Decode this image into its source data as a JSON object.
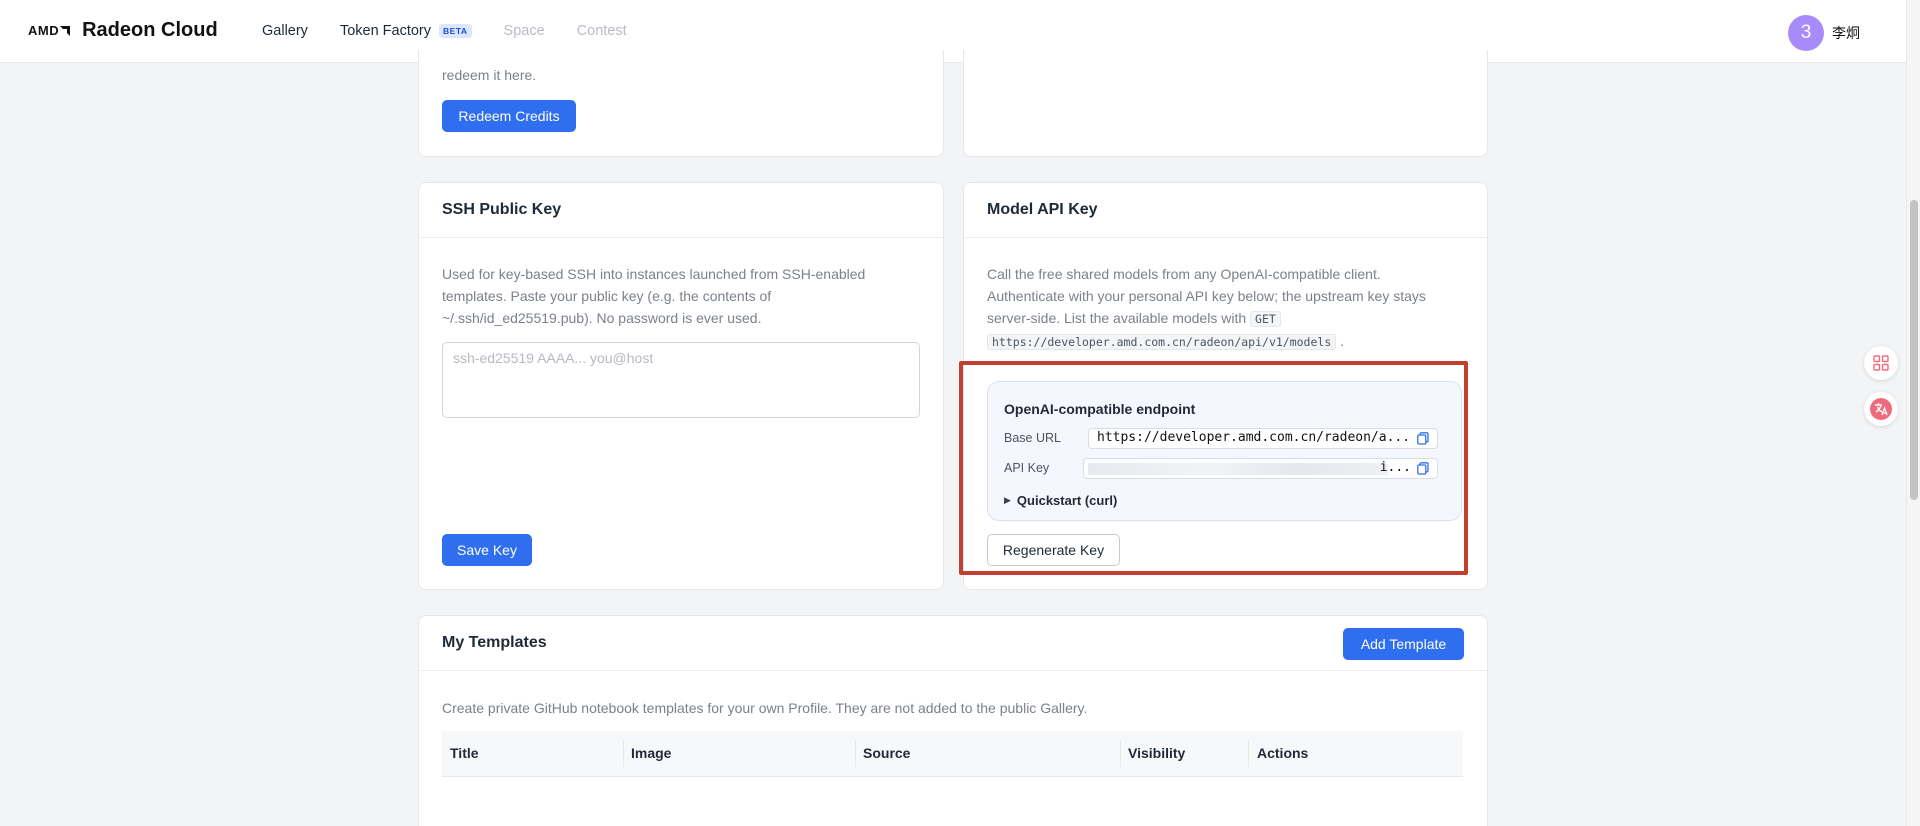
{
  "header": {
    "amd_logo": "AMD",
    "brand": "Radeon Cloud",
    "nav": [
      {
        "label": "Gallery",
        "disabled": false
      },
      {
        "label": "Token Factory",
        "badge": "BETA",
        "disabled": false
      },
      {
        "label": "Space",
        "disabled": true
      },
      {
        "label": "Contest",
        "disabled": true
      }
    ],
    "user": {
      "avatar_text": "3",
      "name": "李炯",
      "avatar_color": "#a78bfa"
    }
  },
  "redeem_card": {
    "text_tail": "redeem it here.",
    "button": "Redeem Credits"
  },
  "ssh_card": {
    "title": "SSH Public Key",
    "description_lines": [
      "Used for key-based SSH into instances launched from SSH-enabled",
      "templates. Paste your public key (e.g. the contents of",
      "~/.ssh/id_ed25519.pub). No password is ever used."
    ],
    "textarea_placeholder": "ssh-ed25519 AAAA... you@host",
    "button": "Save Key"
  },
  "api_card": {
    "title": "Model API Key",
    "description_lines": [
      "Call the free shared models from any OpenAI-compatible client.",
      "Authenticate with your personal API key below; the upstream key stays",
      "server-side. List the available models with"
    ],
    "code_get": "GET",
    "code_url": "https://developer.amd.com.cn/radeon/api/v1/models",
    "trailing_period": ".",
    "endpoint": {
      "title": "OpenAI-compatible endpoint",
      "base_url_label": "Base URL",
      "base_url_value": "https://developer.amd.com.cn/radeon/a...",
      "api_key_label": "API Key",
      "api_key_tail": "і...",
      "quickstart": "Quickstart (curl)"
    },
    "regenerate_button": "Regenerate Key"
  },
  "templates_card": {
    "title": "My Templates",
    "add_button": "Add Template",
    "description": "Create private GitHub notebook templates for your own Profile. They are not added to the public Gallery.",
    "columns": [
      "Title",
      "Image",
      "Source",
      "Visibility",
      "Actions"
    ]
  },
  "colors": {
    "primary": "#2f6fef",
    "highlight": "#c33f2f",
    "beta_text": "#1d4ed8"
  }
}
